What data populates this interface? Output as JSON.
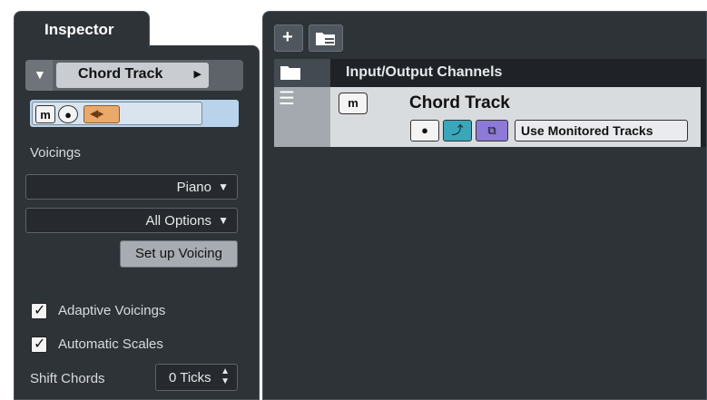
{
  "inspector": {
    "tab_label": "Inspector",
    "track_name": "Chord Track",
    "controls": {
      "mute_label": "m",
      "record_label": "●"
    },
    "voicings_label": "Voicings",
    "voicing_select": "Piano",
    "options_select": "All Options",
    "setup_voicing_label": "Set up Voicing",
    "adaptive_voicings_label": "Adaptive Voicings",
    "adaptive_voicings_checked": true,
    "automatic_scales_label": "Automatic Scales",
    "automatic_scales_checked": true,
    "shift_chords_label": "Shift Chords",
    "shift_chords_value": "0 Ticks"
  },
  "project": {
    "toolbar": {
      "add_label": "+",
      "folder_label": "☰"
    },
    "header_title": "Input/Output Channels",
    "track": {
      "mute_label": "m",
      "name": "Chord Track",
      "record_label": "●",
      "use_monitored_label": "Use Monitored Tracks"
    }
  },
  "colors": {
    "panel_bg": "#2e3338",
    "accent_blue": "#b8d3ea",
    "monitor_orange": "#e9a96b",
    "teal_button": "#3aa6b9",
    "purple_button": "#8c7ad6"
  }
}
